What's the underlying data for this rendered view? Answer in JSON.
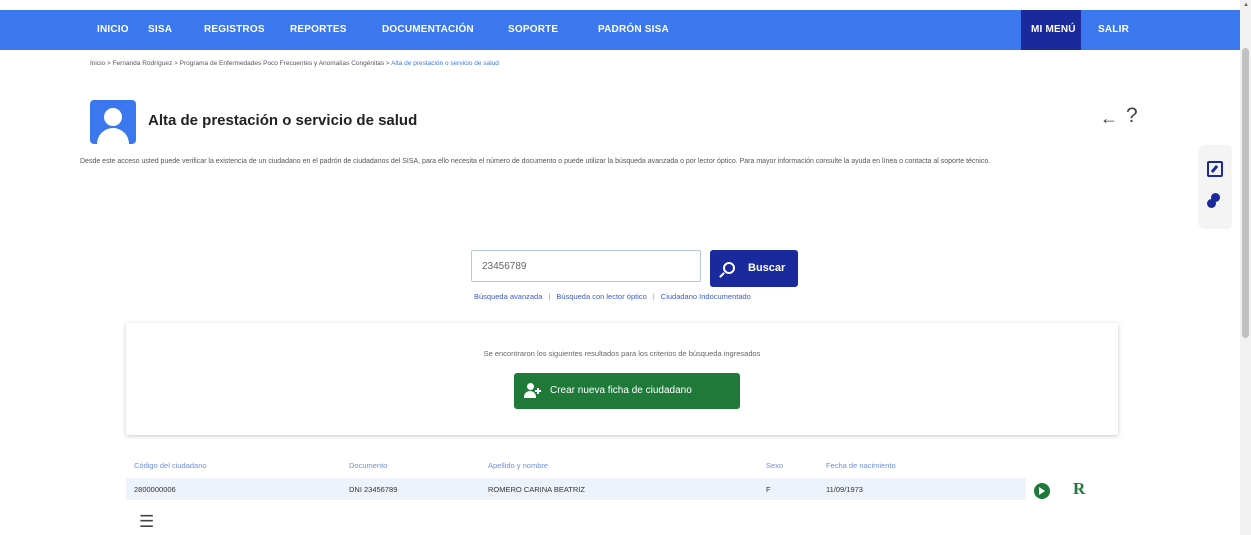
{
  "topnav": {
    "items": [
      "INICIO",
      "SISA",
      "REGISTROS",
      "REPORTES",
      "DOCUMENTACIÓN",
      "SOPORTE",
      "PADRÓN SISA"
    ],
    "right": [
      "MI MENÚ",
      "SALIR"
    ],
    "colors": {
      "bar": "#3b78f0",
      "active": "#1a2a9c"
    }
  },
  "breadcrumb": {
    "path": "Inicio > Fernanda Rodríguez > Programa de Enfermedades Poco Frecuentes y Anomalías Congénitas > ",
    "current": "Alta de prestación o servicio de salud"
  },
  "header": {
    "title": "Alta de prestación o servicio de salud",
    "back_icon": "←",
    "help_icon": "?",
    "description": "Desde este acceso usted puede verificar la existencia de un ciudadano en el padrón de ciudadanos del SISA, para ello necesita el número de documento o puede utilizar la búsqueda avanzada o por lector óptico. Para mayor información consulte la ayuda en línea o contacta al soporte técnico."
  },
  "search": {
    "value": "23456789",
    "button_label": "Buscar",
    "links": [
      "Búsqueda avanzada",
      "Búsqueda con lector óptico",
      "Ciudadano Indocumentado"
    ],
    "separator": "|"
  },
  "results": {
    "message": "Se encontraron los siguientes resultados para los criterios de búsqueda ingresados",
    "create_button": "Crear nueva ficha de ciudadano"
  },
  "table": {
    "headers": [
      "Código del ciudadano",
      "Documento",
      "Apellido y nombre",
      "Sexo",
      "Fecha de nacimiento"
    ],
    "rows": [
      [
        "2800000006",
        "DNI 23456789",
        "ROMERO CARINA BEATRIZ",
        "F",
        "11/09/1973"
      ]
    ],
    "r_label": "R"
  },
  "icons": {
    "menu": "☰",
    "side_tools": [
      "edit-icon",
      "pills-icon"
    ],
    "avatar": "user-avatar-icon"
  }
}
